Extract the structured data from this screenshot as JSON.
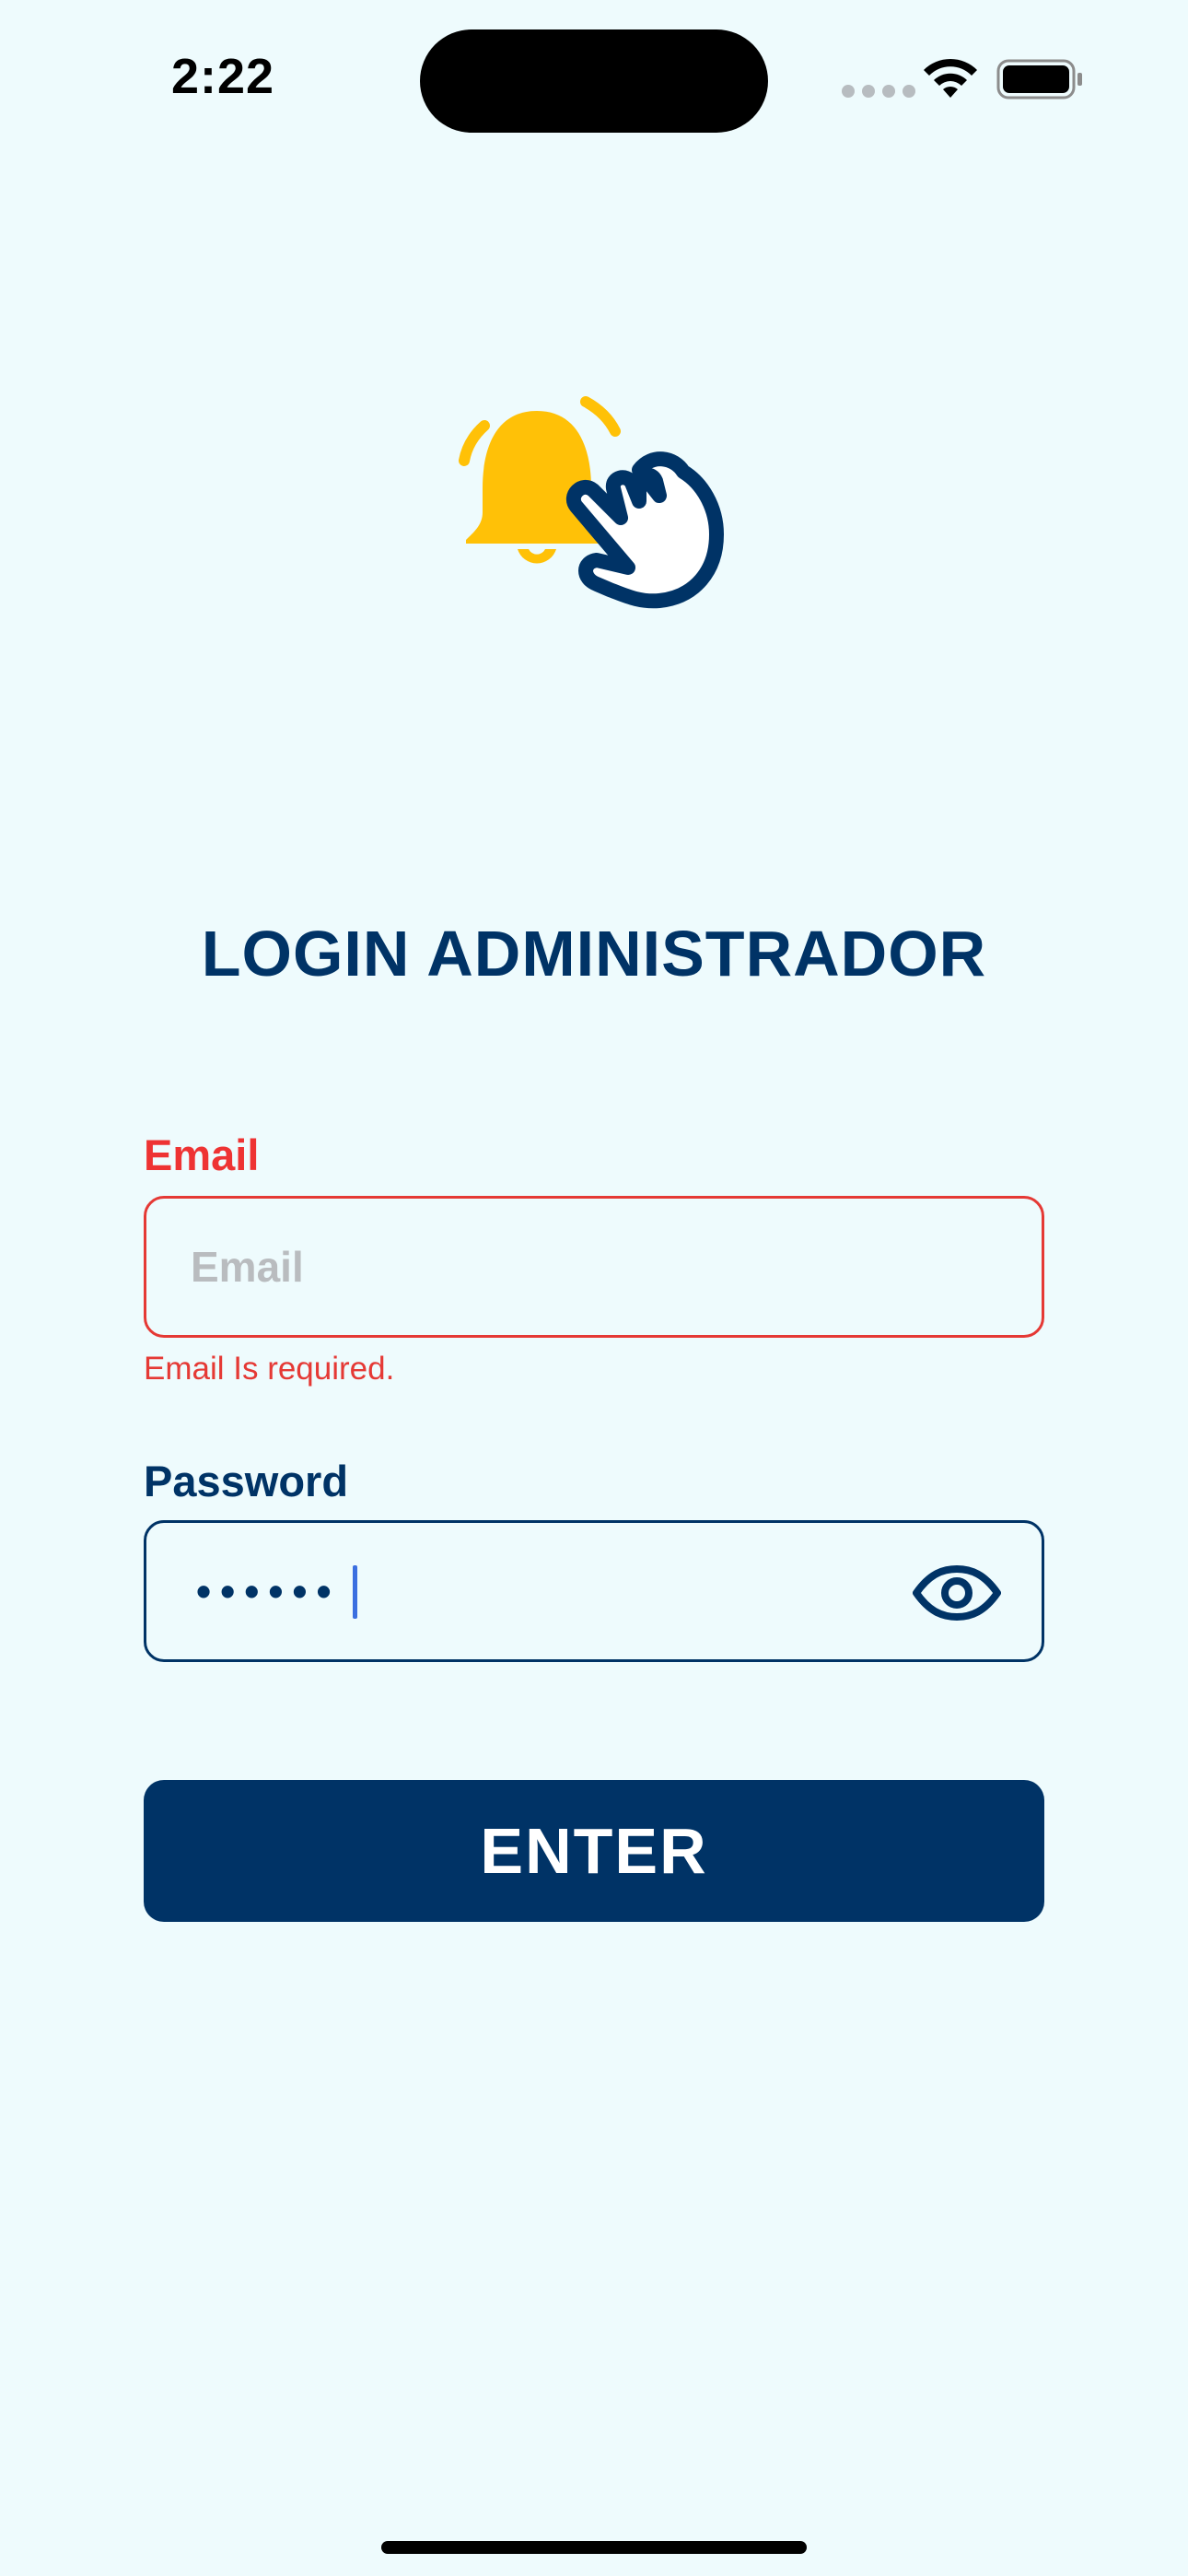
{
  "status_bar": {
    "time": "2:22"
  },
  "logo": {
    "icon": "bell-tap-icon",
    "bell_color": "#FFC107",
    "hand_color": "#003366"
  },
  "title": "LOGIN ADMINISTRADOR",
  "email": {
    "label": "Email",
    "placeholder": "Email",
    "value": "",
    "error": "Email Is required."
  },
  "password": {
    "label": "Password",
    "masked_value": "••••••",
    "toggle_icon": "eye-icon"
  },
  "enter_button": {
    "label": "ENTER"
  },
  "colors": {
    "background": "#EEFBFD",
    "primary": "#003366",
    "error": "#E53935",
    "accent": "#FFC107"
  }
}
